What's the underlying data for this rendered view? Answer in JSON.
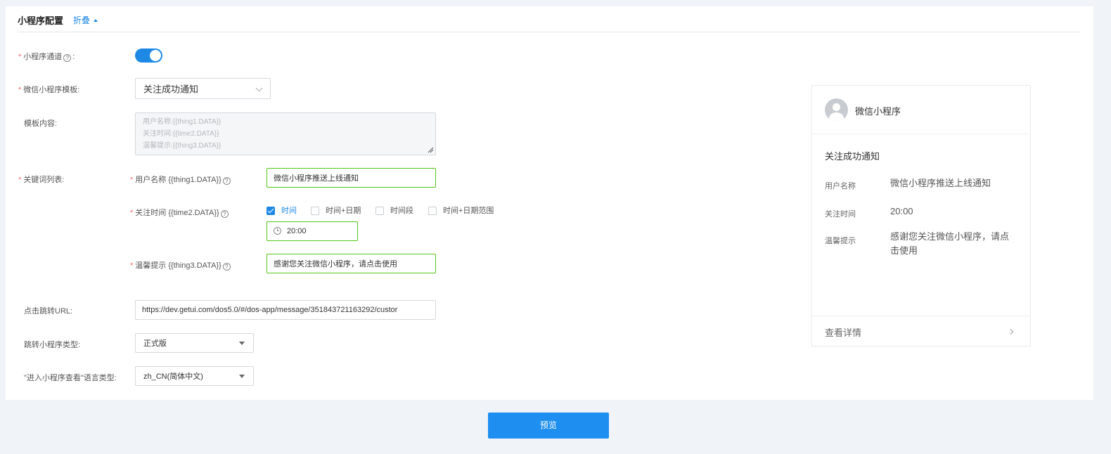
{
  "section": {
    "title": "小程序配置",
    "collapse_label": "折叠"
  },
  "form": {
    "channel_label": "小程序通道",
    "channel_enabled": true,
    "template_label": "微信小程序模板:",
    "template_value": "关注成功通知",
    "content_label": "模板内容:",
    "content_lines": [
      "用户名称:{{thing1.DATA}}",
      "关注时间:{{time2.DATA}}",
      "温馨提示:{{thing3.DATA}}"
    ],
    "keywords_label": "关键词列表:",
    "keywords": [
      {
        "label": "用户名称 {{thing1.DATA}}",
        "value": "微信小程序推送上线通知"
      },
      {
        "label": "关注时间 {{time2.DATA}}",
        "value": "20:00"
      },
      {
        "label": "温馨提示 {{thing3.DATA}}",
        "value": "感谢您关注微信小程序，请点击使用"
      }
    ],
    "time_options": [
      {
        "label": "时间",
        "checked": true
      },
      {
        "label": "时间+日期",
        "checked": false
      },
      {
        "label": "时间段",
        "checked": false
      },
      {
        "label": "时间+日期范围",
        "checked": false
      }
    ],
    "url_label": "点击跳转URL:",
    "url_value": "https://dev.getui.com/dos5.0/#/dos-app/message/351843721163292/custor",
    "type_label": "跳转小程序类型:",
    "type_value": "正式版",
    "lang_label": "\"进入小程序查看\"语言类型:",
    "lang_value": "zh_CN(简体中文)"
  },
  "preview": {
    "app_name": "微信小程序",
    "title": "关注成功通知",
    "rows": [
      {
        "label": "用户名称",
        "value": "微信小程序推送上线通知"
      },
      {
        "label": "关注时间",
        "value": "20:00"
      },
      {
        "label": "温馨提示",
        "value": "感谢您关注微信小程序，请点击使用"
      }
    ],
    "detail_label": "查看详情"
  },
  "actions": {
    "preview_button": "预览"
  },
  "colors": {
    "accent": "#1e88e5",
    "success_border": "#52c41a",
    "required": "#f56c6c"
  }
}
